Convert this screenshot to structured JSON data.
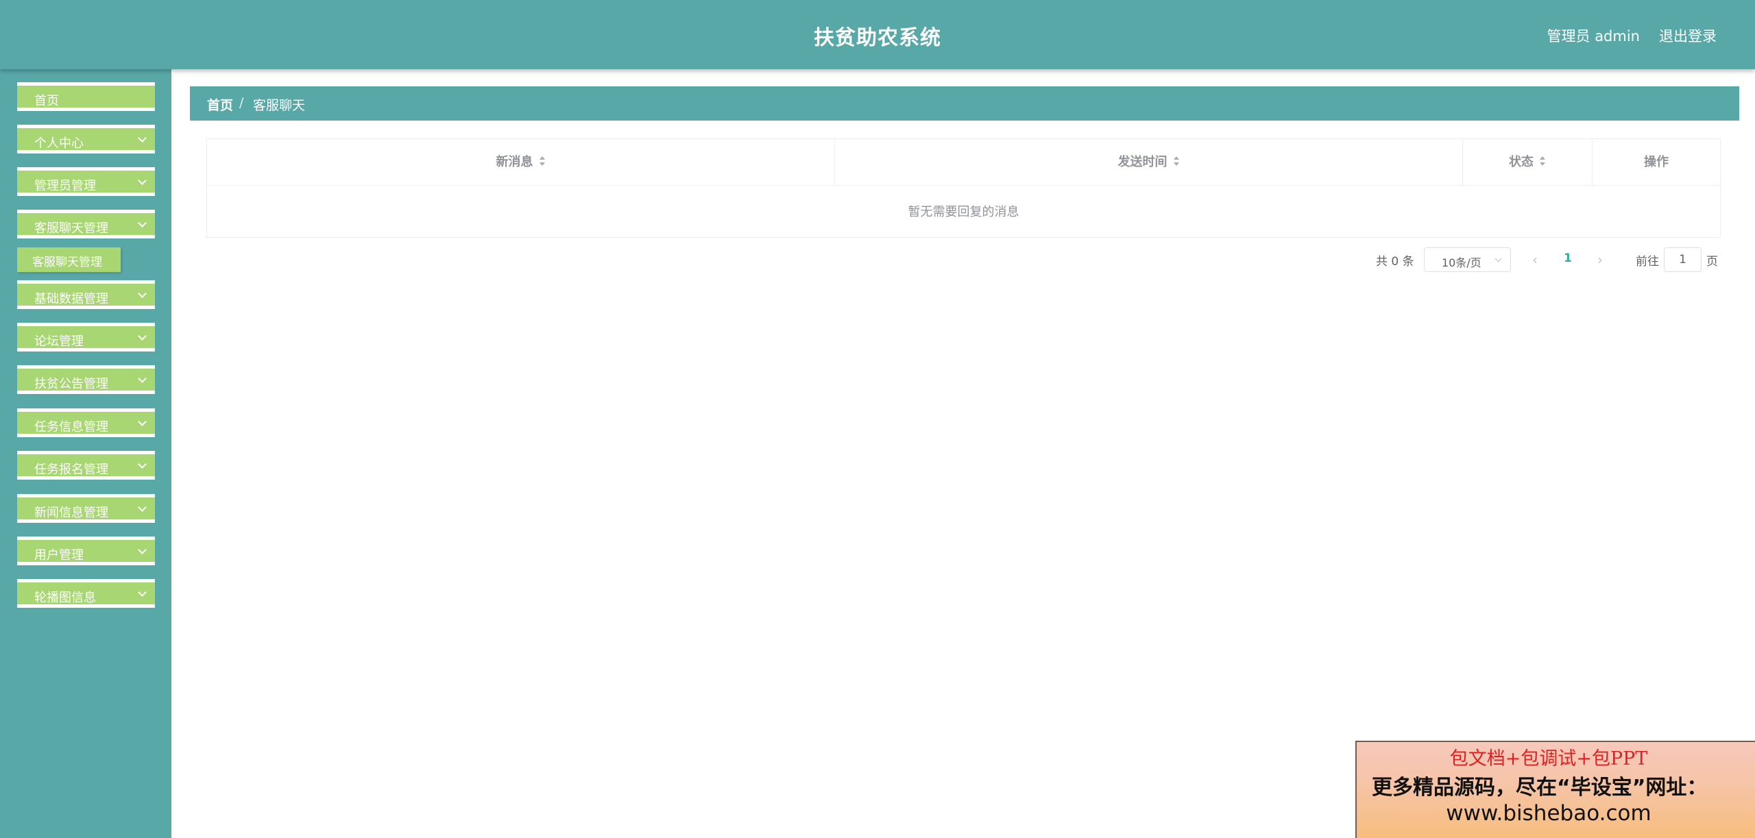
{
  "header": {
    "title": "扶贫助农系统",
    "user": "管理员 admin",
    "logout": "退出登录"
  },
  "sidebar": {
    "items": [
      {
        "label": "首页",
        "has_chevron": false
      },
      {
        "label": "个人中心",
        "has_chevron": true
      },
      {
        "label": "管理员管理",
        "has_chevron": true
      },
      {
        "label": "客服聊天管理",
        "has_chevron": true
      },
      {
        "label": "基础数据管理",
        "has_chevron": true
      },
      {
        "label": "论坛管理",
        "has_chevron": true
      },
      {
        "label": "扶贫公告管理",
        "has_chevron": true
      },
      {
        "label": "任务信息管理",
        "has_chevron": true
      },
      {
        "label": "任务报名管理",
        "has_chevron": true
      },
      {
        "label": "新闻信息管理",
        "has_chevron": true
      },
      {
        "label": "用户管理",
        "has_chevron": true
      },
      {
        "label": "轮播图信息",
        "has_chevron": true
      }
    ],
    "submenu_item": "客服聊天管理"
  },
  "breadcrumb": {
    "home": "首页",
    "separator": "/",
    "current": "客服聊天"
  },
  "table": {
    "columns": [
      "新消息",
      "发送时间",
      "状态",
      "操作"
    ],
    "empty_text": "暂无需要回复的消息"
  },
  "pagination": {
    "total_text": "共 0 条",
    "page_size": "10条/页",
    "current_page": "1",
    "goto_label": "前往",
    "goto_value": "1",
    "page_unit": "页"
  },
  "ad": {
    "line1": "包文档+包调试+包PPT",
    "line2": "更多精品源码，尽在“毕设宝”网址：",
    "line3": "www.bishebao.com"
  },
  "colors": {
    "primary": "#59a8a8",
    "menu": "#a7d672",
    "active_page": "#2ab09c"
  }
}
